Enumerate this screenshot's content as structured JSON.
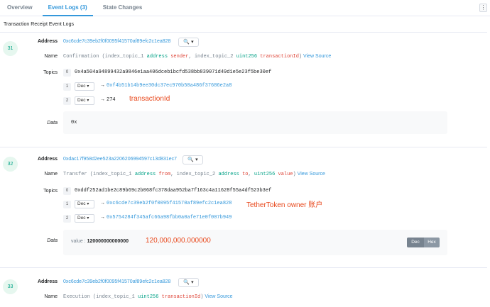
{
  "tabs": {
    "overview": "Overview",
    "event_logs": "Event Logs (3)",
    "state_changes": "State Changes",
    "more": "⋮"
  },
  "subtitle": "Transaction Receipt Event Logs",
  "labels": {
    "address": "Address",
    "name": "Name",
    "topics": "Topics",
    "data": "Data"
  },
  "logs": [
    {
      "index": "31",
      "address": "0xc6cde7c39eb2f0f0095f41570af89efc2c1ea828",
      "name": {
        "pre": "Confirmation (index_topic_1 ",
        "t1": "address",
        "v1": "sender",
        "mid": ", index_topic_2 ",
        "t2": "uint256",
        "v2": "transactionId",
        "post": ")",
        "link": "View Source"
      },
      "topics": [
        {
          "idx": "0",
          "value": "0x4a504a94899432a9846e1aa406dceb1bcfd538bb839071d49d1e5e23f5be30ef"
        },
        {
          "idx": "1",
          "select": "Dec",
          "arrow": "→",
          "value": "0xf4b51b14b9ee30dc37ec970b50a486f37686e2a8"
        },
        {
          "idx": "2",
          "select": "Dec",
          "arrow": "→",
          "value": "274"
        }
      ],
      "annotation": "transactionId",
      "data": "0x"
    },
    {
      "index": "32",
      "address": "0xdac17f958d2ee523a2206206994597c13d831ec7",
      "name": {
        "pre": "Transfer (index_topic_1 ",
        "t1": "address",
        "v1": "from",
        "mid": ", index_topic_2 ",
        "t2": "address",
        "v2": "to",
        "mid2": ", ",
        "t3": "uint256",
        "v3": "value",
        "post": ")",
        "link": "View Source"
      },
      "topics": [
        {
          "idx": "0",
          "value": "0xddf252ad1be2c89b69c2b068fc378daa952ba7f163c4a11628f55a4df523b3ef"
        },
        {
          "idx": "1",
          "select": "Dec",
          "arrow": "→",
          "value": "0xc6cde7c39eb2f0f0095f41570af89efc2c1ea828"
        },
        {
          "idx": "2",
          "select": "Dec",
          "arrow": "→",
          "value": "0x5754284f345afc66a98fbb0a0afe71e0f007b949"
        }
      ],
      "annotation": "TetherToken owner 账户",
      "data_label": "value : ",
      "data_value": "120000000000000",
      "data_annotation": "120,000,000.000000",
      "toggle": {
        "dec": "Dec",
        "hex": "Hex"
      }
    },
    {
      "index": "33",
      "address": "0xc6cde7c39eb2f0f0095f41570af89efc2c1ea828",
      "name": {
        "pre": "Execution (index_topic_1 ",
        "t1": "uint256",
        "v1": "transactionId",
        "post": ")",
        "link": "View Source"
      }
    }
  ],
  "colors": {
    "accent": "#3498db",
    "annotation": "#e8491d",
    "circle_bg": "#e6f7ef",
    "circle_text": "#00a186"
  },
  "icons": {
    "zoom": "magnifier-icon",
    "caret": "chevron-down-icon"
  }
}
